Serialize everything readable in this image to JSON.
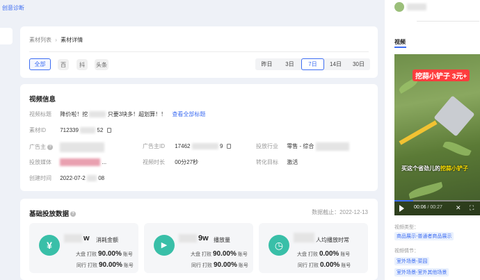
{
  "top_link": "创意诊断",
  "breadcrumb": {
    "parent": "素材列表",
    "sep": "›",
    "current": "素材详情"
  },
  "filters": {
    "all": "全部",
    "platforms": [
      "百",
      "抖",
      "头条"
    ],
    "days": [
      "昨日",
      "3日",
      "7日",
      "14日",
      "30日"
    ],
    "active_day": "7日"
  },
  "video_info": {
    "title": "视频信息",
    "title_label": "视频标题",
    "title_value_a": "降价啦！挖",
    "title_value_b": "只要3块多！超划算！！",
    "view_all": "查看全部标题",
    "id_label": "素材ID",
    "id_value_a": "712339",
    "id_value_b": "52",
    "advertiser_label": "广告主",
    "advertiser_id_label": "广告主ID",
    "advertiser_id_a": "17462",
    "advertiser_id_b": "9",
    "industry_label": "投放行业",
    "industry_value": "零售 - 综合",
    "media_label": "投放媒体",
    "media_more": "...",
    "duration_label": "视频时长",
    "duration_value": "00分27秒",
    "target_label": "转化目标",
    "target_value": "激活",
    "created_label": "创建时间",
    "created_a": "2022-07-2",
    "created_b": "08"
  },
  "base_data": {
    "title": "基础投放数据",
    "deadline": "数据截止：2022-12-13",
    "metrics": [
      {
        "icon": "yen-icon",
        "glyph": "¥",
        "value": "w",
        "label": "消耗金额",
        "r1_label": "大盘",
        "r1_act": "打败",
        "r1_pct": "90.00%",
        "r1_unit": "账号",
        "r2_label": "同行",
        "r2_act": "打败",
        "r2_pct": "90.00%",
        "r2_unit": "账号"
      },
      {
        "icon": "play-circle-icon",
        "glyph": "▶",
        "value": "9w",
        "label": "播放量",
        "r1_label": "大盘",
        "r1_act": "打败",
        "r1_pct": "90.00%",
        "r1_unit": "账号",
        "r2_label": "同行",
        "r2_act": "打败",
        "r2_pct": "90.00%",
        "r2_unit": "账号"
      },
      {
        "icon": "timer-icon",
        "glyph": "◷",
        "value": "",
        "label": "人均播放时常",
        "r1_label": "大盘",
        "r1_act": "打败",
        "r1_pct": "0.00%",
        "r1_unit": "账号",
        "r2_label": "同行",
        "r2_act": "打败",
        "r2_pct": "0.00%",
        "r2_unit": "账号"
      }
    ]
  },
  "right_panel": {
    "tab": "视频",
    "video_caption_top": "挖蒜小铲子 3元+",
    "video_subtitle_a": "买这个省劲儿的",
    "video_subtitle_b": "挖蒜小铲子",
    "time_current": "00:06",
    "time_total": "/ 00:27",
    "progress": 0.22,
    "type_label": "视频类型：",
    "type_tag": "商品展示-普通者商品展示",
    "plot_label": "视频情节：",
    "plot_tags": [
      "室外场景-菜园",
      "室外场景-室外其他场景"
    ]
  },
  "colors": {
    "accent": "#3d6df2",
    "icon_green": "#39bfa8"
  }
}
